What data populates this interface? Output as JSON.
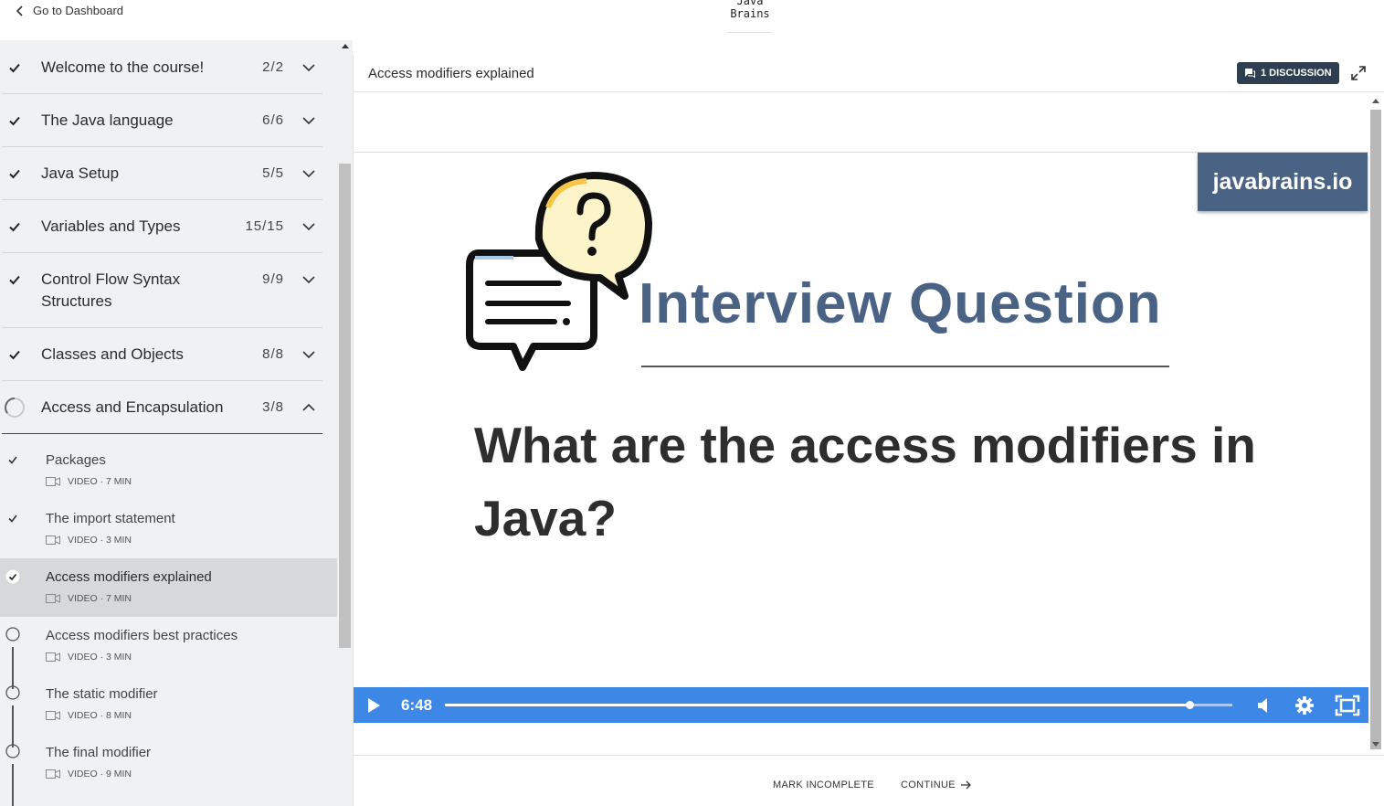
{
  "topbar": {
    "back_label": "Go to Dashboard",
    "logo_line1": "Java",
    "logo_line2": "Brains"
  },
  "sidebar": {
    "sections": [
      {
        "title": "Welcome to the course!",
        "count": "2/2",
        "status": "complete"
      },
      {
        "title": "The Java language",
        "count": "6/6",
        "status": "complete"
      },
      {
        "title": "Java Setup",
        "count": "5/5",
        "status": "complete"
      },
      {
        "title": "Variables and Types",
        "count": "15/15",
        "status": "complete"
      },
      {
        "title": "Control Flow Syntax Structures",
        "count": "9/9",
        "status": "complete"
      },
      {
        "title": "Classes and Objects",
        "count": "8/8",
        "status": "complete"
      },
      {
        "title": "Access and Encapsulation",
        "count": "3/8",
        "status": "in-progress"
      }
    ],
    "lessons": [
      {
        "title": "Packages",
        "meta": "VIDEO · 7 MIN",
        "status": "complete"
      },
      {
        "title": "The import statement",
        "meta": "VIDEO · 3 MIN",
        "status": "complete"
      },
      {
        "title": "Access modifiers explained",
        "meta": "VIDEO · 7 MIN",
        "status": "complete"
      },
      {
        "title": "Access modifiers best practices",
        "meta": "VIDEO · 3 MIN",
        "status": "incomplete"
      },
      {
        "title": "The static modifier",
        "meta": "VIDEO · 8 MIN",
        "status": "incomplete"
      },
      {
        "title": "The final modifier",
        "meta": "VIDEO · 9 MIN",
        "status": "incomplete"
      }
    ]
  },
  "main": {
    "lesson_title": "Access modifiers explained",
    "discussion_label": "1 DISCUSSION",
    "video": {
      "brand": "javabrains.io",
      "heading": "Interview Question",
      "question": "What are the access modifiers in Java?",
      "time": "6:48",
      "progress": 0.945
    },
    "footer": {
      "mark_incomplete": "MARK INCOMPLETE",
      "continue": "CONTINUE"
    }
  },
  "colors": {
    "accent": "#3d87e6",
    "brand": "#4a6284",
    "discussion": "#2c3e50"
  }
}
